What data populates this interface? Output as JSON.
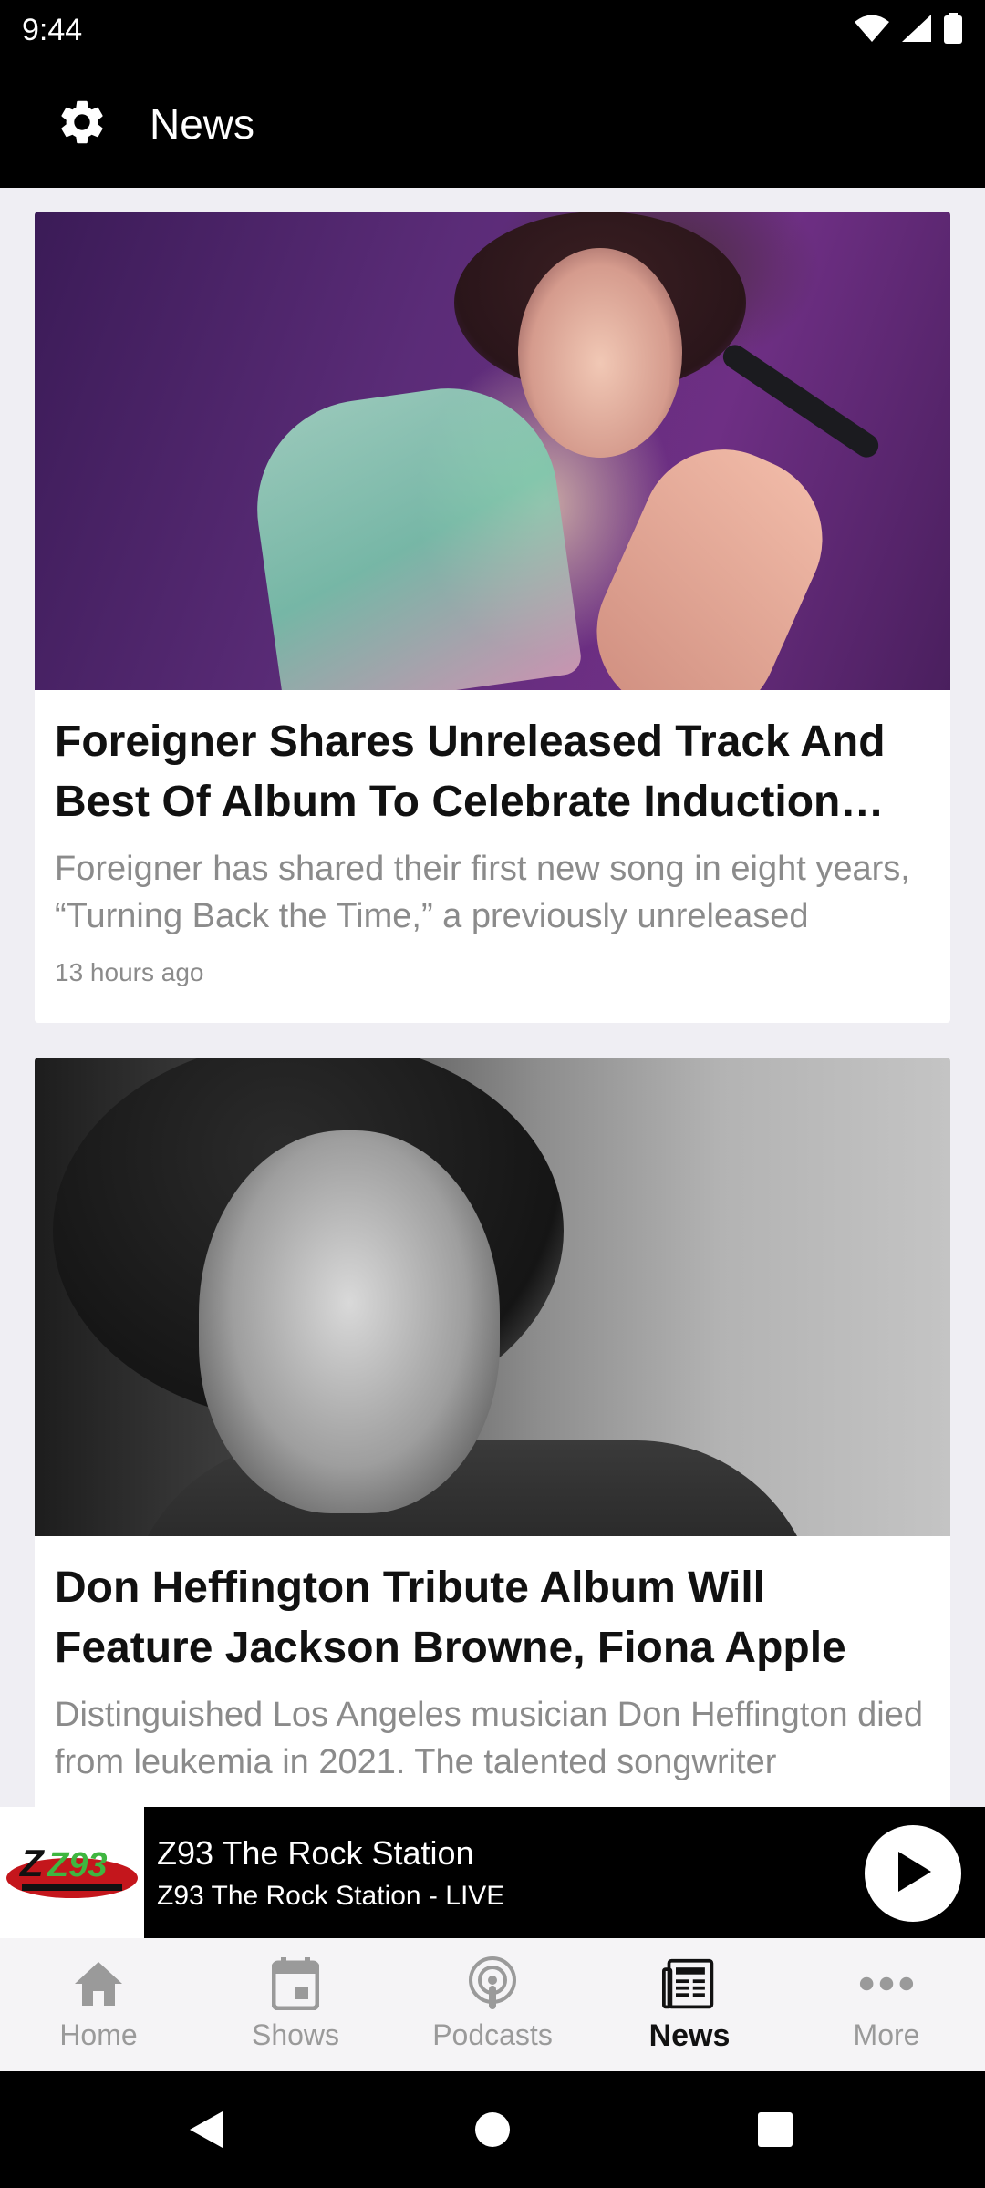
{
  "status_bar": {
    "time": "9:44",
    "icons": [
      "wifi-icon",
      "signal-icon",
      "battery-icon"
    ]
  },
  "app_bar": {
    "title": "News",
    "settings_icon": "gear-icon"
  },
  "articles": [
    {
      "headline": "Foreigner Shares Unreleased Track And Best Of Album To Celebrate Induction Into",
      "summary": "Foreigner has shared their first new song in eight years, “Turning Back the Time,” a previously unreleased",
      "time": "13 hours ago"
    },
    {
      "headline": "Don Heffington Tribute Album Will Feature Jackson Browne, Fiona Apple",
      "summary": "Distinguished Los Angeles musician Don Heffington died from leukemia in 2021. The talented songwriter",
      "time": ""
    }
  ],
  "player": {
    "title": "Z93 The Rock Station",
    "subtitle": "Z93 The Rock Station - LIVE",
    "logo_text": "Z93",
    "play_icon": "play-icon"
  },
  "bottom_nav": {
    "items": [
      {
        "label": "Home",
        "icon": "home-icon",
        "active": false
      },
      {
        "label": "Shows",
        "icon": "calendar-icon",
        "active": false
      },
      {
        "label": "Podcasts",
        "icon": "podcast-icon",
        "active": false
      },
      {
        "label": "News",
        "icon": "newspaper-icon",
        "active": true
      },
      {
        "label": "More",
        "icon": "more-icon",
        "active": false
      }
    ]
  },
  "colors": {
    "background": "#efeef3",
    "bar": "#000000",
    "inactive_nav": "#9a9a9a",
    "active_nav": "#111111",
    "summary_text": "#8b8b8b"
  }
}
